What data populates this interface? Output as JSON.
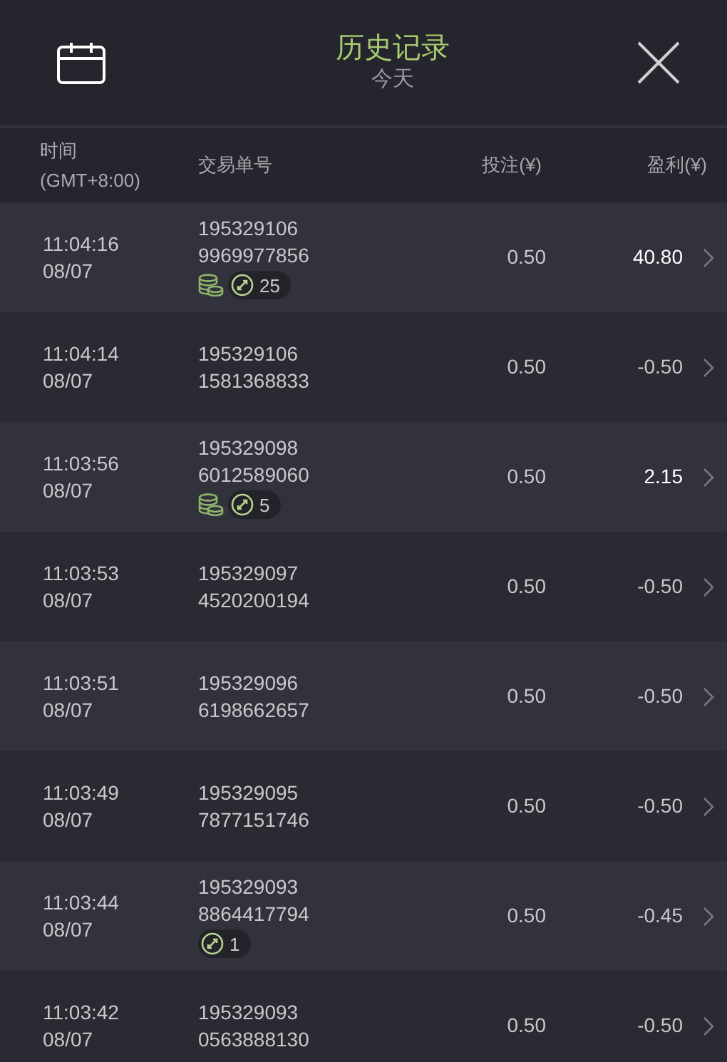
{
  "header": {
    "title": "历史记录",
    "subtitle": "今天"
  },
  "columns": {
    "time": [
      "时间",
      "(GMT+8:00)"
    ],
    "order": "交易单号",
    "bet": "投注(¥)",
    "profit": "盈利(¥)"
  },
  "rows": [
    {
      "time": "11:04:16",
      "date": "08/07",
      "order": [
        "195329106",
        "9969977856"
      ],
      "coins": true,
      "multiplier": "25",
      "bet": "0.50",
      "profit": "40.80",
      "win": true
    },
    {
      "time": "11:04:14",
      "date": "08/07",
      "order": [
        "195329106",
        "1581368833"
      ],
      "coins": false,
      "bet": "0.50",
      "profit": "-0.50",
      "win": false
    },
    {
      "time": "11:03:56",
      "date": "08/07",
      "order": [
        "195329098",
        "6012589060"
      ],
      "coins": true,
      "multiplier": "5",
      "bet": "0.50",
      "profit": "2.15",
      "win": true
    },
    {
      "time": "11:03:53",
      "date": "08/07",
      "order": [
        "195329097",
        "4520200194"
      ],
      "coins": false,
      "bet": "0.50",
      "profit": "-0.50",
      "win": false
    },
    {
      "time": "11:03:51",
      "date": "08/07",
      "order": [
        "195329096",
        "6198662657"
      ],
      "coins": false,
      "bet": "0.50",
      "profit": "-0.50",
      "win": false
    },
    {
      "time": "11:03:49",
      "date": "08/07",
      "order": [
        "195329095",
        "7877151746"
      ],
      "coins": false,
      "bet": "0.50",
      "profit": "-0.50",
      "win": false
    },
    {
      "time": "11:03:44",
      "date": "08/07",
      "order": [
        "195329093",
        "8864417794"
      ],
      "coins": false,
      "multiplier": "1",
      "bet": "0.50",
      "profit": "-0.45",
      "win": false
    },
    {
      "time": "11:03:42",
      "date": "08/07",
      "order": [
        "195329093",
        "0563888130"
      ],
      "coins": false,
      "bet": "0.50",
      "profit": "-0.50",
      "win": false
    }
  ]
}
